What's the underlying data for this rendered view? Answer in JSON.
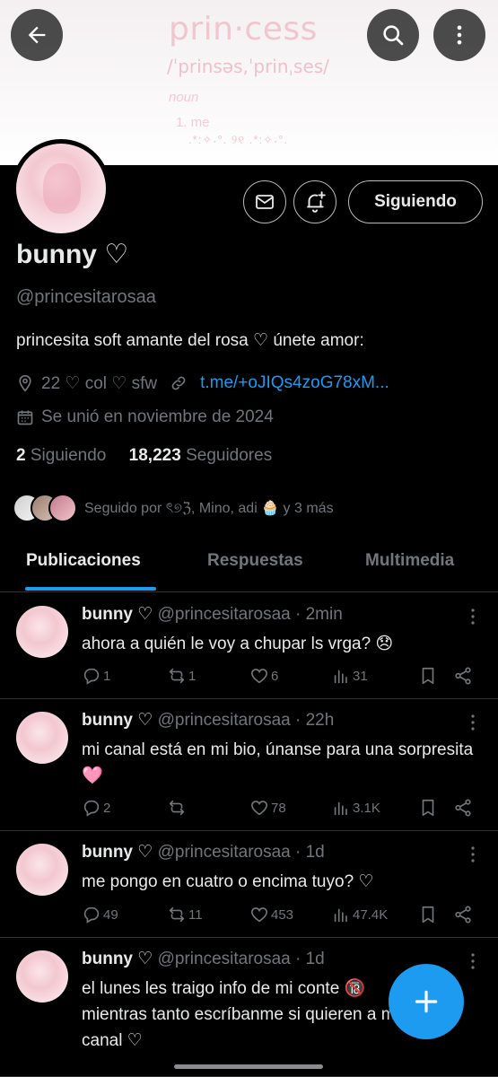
{
  "banner": {
    "word": "prin·cess",
    "phonetic": "/ˈprinsəs,ˈprinˌses/",
    "noun": "noun",
    "definition": "1. me",
    "decoration": ".*:✧˖°. ୨୧ .*:✧˖°."
  },
  "header": {
    "back_icon": "arrow-left-icon",
    "search_icon": "search-icon",
    "more_icon": "more-vertical-icon"
  },
  "profile": {
    "name": "bunny ♡",
    "handle": "@princesitarosaa",
    "bio": "princesita soft amante del rosa ♡ únete amor:",
    "location": "22 ♡ col ♡ sfw",
    "link": "t.me/+oJIQs4zoG78xM...",
    "joined": "Se unió en noviembre de 2024",
    "following_count": "2",
    "following_label": "Siguiendo",
    "followers_count": "18,223",
    "followers_label": "Seguidores",
    "followed_by": "Seguido por ৎ୭ℨ, Mino, adi 🧁 y 3 más",
    "follow_button": "Siguiendo"
  },
  "tabs": [
    "Publicaciones",
    "Respuestas",
    "Multimedia"
  ],
  "posts": [
    {
      "name": "bunny ♡",
      "meta": "@princesitarosaa · 2min",
      "text": "ahora a quién le voy a chupar ls vrga? 😞",
      "replies": "1",
      "reposts": "1",
      "likes": "6",
      "views": "31"
    },
    {
      "name": "bunny ♡",
      "meta": "@princesitarosaa · 22h",
      "text": "mi canal está en mi bio, únanse para una sorpresita 🩷",
      "replies": "2",
      "reposts": "",
      "likes": "78",
      "views": "3.1K"
    },
    {
      "name": "bunny ♡",
      "meta": "@princesitarosaa · 1d",
      "text": "me pongo en cuatro o encima tuyo? ♡",
      "replies": "49",
      "reposts": "11",
      "likes": "453",
      "views": "47.4K"
    },
    {
      "name": "bunny ♡",
      "meta": "@princesitarosaa · 1d",
      "text": "el lunes les traigo info de mi conte 🔞 mientras tanto escríbanme si quieren a mi canal ♡"
    }
  ],
  "colors": {
    "accent": "#1d9bf0",
    "background": "#000000",
    "text_primary": "#e7e9ea",
    "text_secondary": "#71767b"
  }
}
